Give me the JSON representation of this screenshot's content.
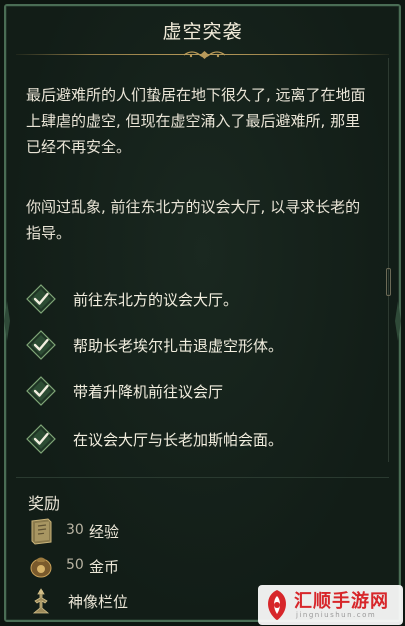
{
  "quest": {
    "title": "虚空突袭",
    "description": [
      "最后避难所的人们蛰居在地下很久了, 远离了在地面上肆虐的虚空, 但现在虚空涌入了最后避难所, 那里已经不再安全。",
      "你闯过乱象, 前往东北方的议会大厅, 以寻求长老的指导。"
    ],
    "objectives": [
      {
        "text": "前往东北方的议会大厅。",
        "completed": true
      },
      {
        "text": "帮助长老埃尔扎击退虚空形体。",
        "completed": true
      },
      {
        "text": "带着升降机前往议会厅",
        "completed": true
      },
      {
        "text": "在议会大厅与长老加斯帕会面。",
        "completed": true
      }
    ]
  },
  "rewards": {
    "title": "奖励",
    "items": [
      {
        "amount": "30",
        "label": "经验",
        "icon": "book-icon"
      },
      {
        "amount": "50",
        "label": "金币",
        "icon": "coin-pouch-icon"
      },
      {
        "amount": "",
        "label": "神像栏位",
        "icon": "idol-icon"
      }
    ]
  },
  "watermark": {
    "text": "汇顺手游网",
    "sub": "jingniushun.com"
  },
  "colors": {
    "background": "#121d17",
    "border": "#4a6d55",
    "accent_gold": "#b89a5a",
    "check_green": "#3f7a45",
    "text": "#e9e4d6"
  }
}
